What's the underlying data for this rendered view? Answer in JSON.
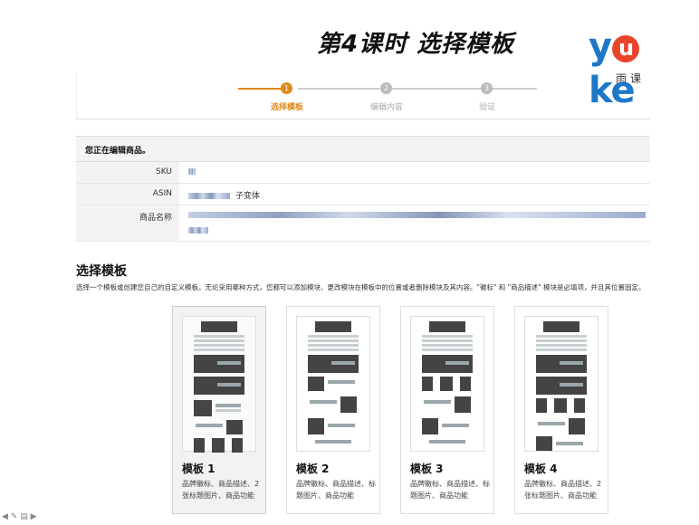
{
  "slide": {
    "title": "第4课时 选择模板"
  },
  "logo": {
    "word_pre": "y",
    "word_mid": "u",
    "word_post": "ke",
    "subtitle": "雨课"
  },
  "wizard": {
    "steps": [
      {
        "num": "1",
        "label": "选择模板",
        "active": true
      },
      {
        "num": "2",
        "label": "编辑内容",
        "active": false
      },
      {
        "num": "3",
        "label": "验证",
        "active": false
      }
    ],
    "colors": {
      "active": "#e08a1e",
      "inactive": "#bbbbbb"
    }
  },
  "product_info": {
    "header": "您正在编辑商品。",
    "rows": [
      {
        "label": "SKU",
        "value": ""
      },
      {
        "label": "ASIN",
        "value": "子变体"
      },
      {
        "label": "商品名称",
        "value": ""
      }
    ]
  },
  "choose": {
    "title": "选择模板",
    "description": "选择一个模板或创建您自己的自定义模板。无论采用哪种方式，您都可以添加模块、更改模块在模板中的位置或者删除模块及其内容。\"徽标\" 和 \"商品描述\" 模块是必填项，并且其位置固定。"
  },
  "templates": [
    {
      "name": "模板 1",
      "desc": "品牌徽标、商品描述、2张标题图片、商品功能",
      "selected": true
    },
    {
      "name": "模板 2",
      "desc": "品牌徽标、商品描述、标题图片、商品功能",
      "selected": false
    },
    {
      "name": "模板 3",
      "desc": "品牌徽标、商品描述、标题图片、商品功能",
      "selected": false
    },
    {
      "name": "模板 4",
      "desc": "品牌徽标、商品描述、2张标题图片、商品功能",
      "selected": false
    }
  ],
  "toolbar_icons": [
    "prev-icon",
    "pen-icon",
    "menu-icon",
    "next-icon"
  ]
}
